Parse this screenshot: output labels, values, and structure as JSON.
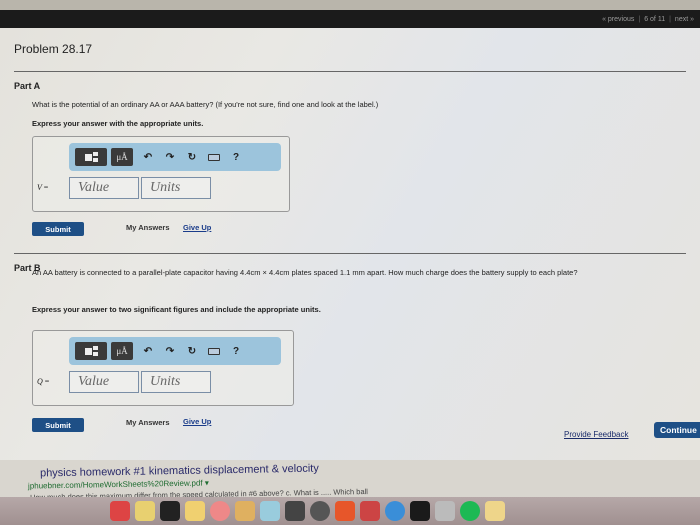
{
  "navbar": {
    "previous_label": "« previous",
    "position": "6 of 11",
    "next_label": "next »"
  },
  "problem": {
    "title": "Problem 28.17"
  },
  "part_a": {
    "label": "Part A",
    "question": "What is the potential of an ordinary AA or AAA battery? (If you're not sure, find one and look at the label.)",
    "instruction": "Express your answer with the appropriate units.",
    "variable": "V",
    "equals": "=",
    "value_placeholder": "Value",
    "units_placeholder": "Units",
    "toolbar": {
      "units_button": "μÅ",
      "help": "?"
    },
    "submit_label": "Submit",
    "my_answers_label": "My Answers",
    "give_up_label": "Give Up"
  },
  "part_b": {
    "label": "Part B",
    "question": "An AA battery is connected to a parallel-plate capacitor having 4.4cm × 4.4cm plates spaced 1.1 mm apart. How much charge does the battery supply to each plate?",
    "instruction": "Express your answer to two significant figures and include the appropriate units.",
    "variable": "Q",
    "equals": "=",
    "value_placeholder": "Value",
    "units_placeholder": "Units",
    "toolbar": {
      "units_button": "μÅ",
      "help": "?"
    },
    "submit_label": "Submit",
    "my_answers_label": "My Answers",
    "give_up_label": "Give Up"
  },
  "footer": {
    "feedback_label": "Provide Feedback",
    "continue_label": "Continue"
  },
  "search_result": {
    "title": "physics homework #1 kinematics displacement & velocity",
    "url": "jphuebner.com/HomeWorkSheets%20Review.pdf ▾",
    "snippet": "How much does this maximum differ from the speed calculated in #6 above? c. What is ..... Which ball"
  },
  "colors": {
    "accent_blue": "#1e4f86",
    "toolbar_blue": "#9cc4dc",
    "navbar_dark": "#1b1b1b"
  }
}
